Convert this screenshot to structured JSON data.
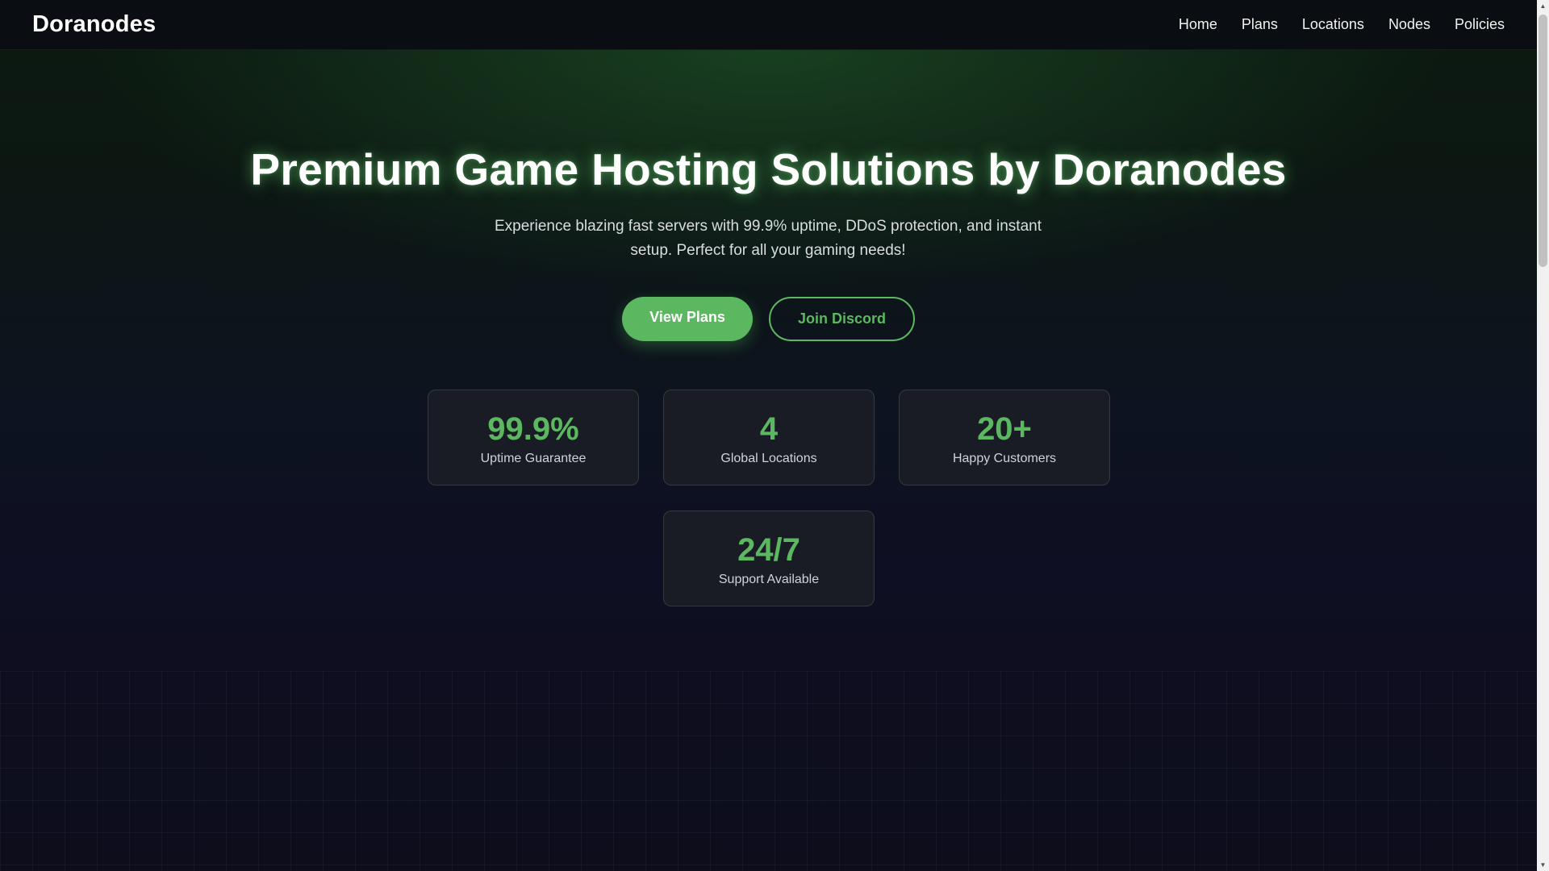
{
  "navbar": {
    "brand": "Doranodes",
    "links": [
      "Home",
      "Plans",
      "Locations",
      "Nodes",
      "Policies"
    ]
  },
  "hero": {
    "title": "Premium Game Hosting Solutions by Doranodes",
    "subtitle": "Experience blazing fast servers with 99.9% uptime, DDoS protection, and instant setup. Perfect for all your gaming needs!",
    "primary_button": "View Plans",
    "secondary_button": "Join Discord"
  },
  "stats": [
    {
      "value": "99.9%",
      "label": "Uptime Guarantee"
    },
    {
      "value": "4",
      "label": "Global Locations"
    },
    {
      "value": "20+",
      "label": "Happy Customers"
    },
    {
      "value": "24/7",
      "label": "Support Available"
    }
  ],
  "colors": {
    "accent": "#5cb860",
    "background": "#0d0d1a"
  },
  "scrollbar": {
    "up_arrow": "▲",
    "down_arrow": "▼"
  }
}
